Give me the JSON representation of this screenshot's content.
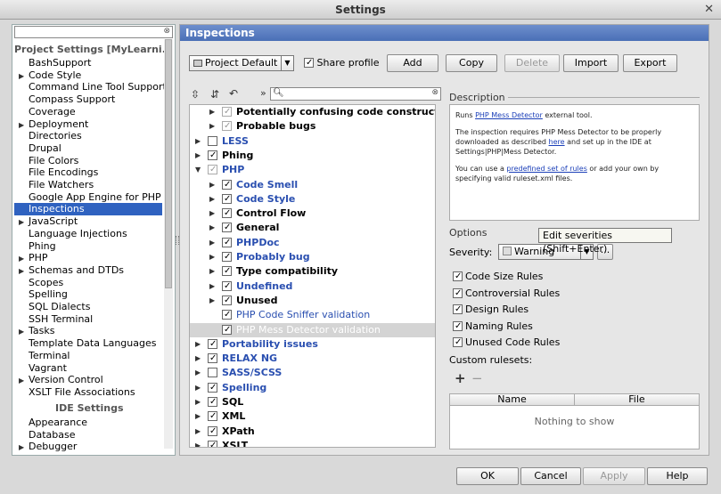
{
  "window": {
    "title": "Settings",
    "close_glyph": "✕"
  },
  "left": {
    "search_clear": "⊗",
    "project_header": "Project Settings [MyLearni...",
    "ide_header": "IDE Settings",
    "items": [
      {
        "label": "BashSupport",
        "arrow": ""
      },
      {
        "label": "Code Style",
        "arrow": "▶"
      },
      {
        "label": "Command Line Tool Support",
        "arrow": ""
      },
      {
        "label": "Compass Support",
        "arrow": ""
      },
      {
        "label": "Coverage",
        "arrow": ""
      },
      {
        "label": "Deployment",
        "arrow": "▶"
      },
      {
        "label": "Directories",
        "arrow": ""
      },
      {
        "label": "Drupal",
        "arrow": ""
      },
      {
        "label": "File Colors",
        "arrow": ""
      },
      {
        "label": "File Encodings",
        "arrow": ""
      },
      {
        "label": "File Watchers",
        "arrow": ""
      },
      {
        "label": "Google App Engine for PHP",
        "arrow": ""
      },
      {
        "label": "Inspections",
        "arrow": "",
        "selected": true
      },
      {
        "label": "JavaScript",
        "arrow": "▶"
      },
      {
        "label": "Language Injections",
        "arrow": ""
      },
      {
        "label": "Phing",
        "arrow": ""
      },
      {
        "label": "PHP",
        "arrow": "▶"
      },
      {
        "label": "Schemas and DTDs",
        "arrow": "▶"
      },
      {
        "label": "Scopes",
        "arrow": ""
      },
      {
        "label": "Spelling",
        "arrow": ""
      },
      {
        "label": "SQL Dialects",
        "arrow": ""
      },
      {
        "label": "SSH Terminal",
        "arrow": ""
      },
      {
        "label": "Tasks",
        "arrow": "▶"
      },
      {
        "label": "Template Data Languages",
        "arrow": ""
      },
      {
        "label": "Terminal",
        "arrow": ""
      },
      {
        "label": "Vagrant",
        "arrow": ""
      },
      {
        "label": "Version Control",
        "arrow": "▶"
      },
      {
        "label": "XSLT File Associations",
        "arrow": ""
      }
    ],
    "ide_items": [
      {
        "label": "Appearance",
        "arrow": ""
      },
      {
        "label": "Database",
        "arrow": ""
      },
      {
        "label": "Debugger",
        "arrow": "▶"
      }
    ]
  },
  "right": {
    "header": "Inspections",
    "profile": "Project Default",
    "share_profile": "Share profile",
    "buttons": {
      "add": "Add",
      "copy": "Copy",
      "delete": "Delete",
      "import": "Import",
      "export": "Export"
    },
    "filter_prefix": "»",
    "search_clear": "⊗",
    "tree": [
      {
        "label": "Potentially confusing code constructs",
        "level": 1,
        "arrow": "▶",
        "checked": "dim",
        "style": "bold"
      },
      {
        "label": "Probable bugs",
        "level": 1,
        "arrow": "▶",
        "checked": "dim",
        "style": "bold"
      },
      {
        "label": "LESS",
        "level": 0,
        "arrow": "▶",
        "checked": "off",
        "style": "blue"
      },
      {
        "label": "Phing",
        "level": 0,
        "arrow": "▶",
        "checked": "on",
        "style": "bold"
      },
      {
        "label": "PHP",
        "level": 0,
        "arrow": "▼",
        "checked": "dim",
        "style": "blue"
      },
      {
        "label": "Code Smell",
        "level": 1,
        "arrow": "▶",
        "checked": "on",
        "style": "blue"
      },
      {
        "label": "Code Style",
        "level": 1,
        "arrow": "▶",
        "checked": "on",
        "style": "blue"
      },
      {
        "label": "Control Flow",
        "level": 1,
        "arrow": "▶",
        "checked": "on",
        "style": "bold"
      },
      {
        "label": "General",
        "level": 1,
        "arrow": "▶",
        "checked": "on",
        "style": "bold"
      },
      {
        "label": "PHPDoc",
        "level": 1,
        "arrow": "▶",
        "checked": "on",
        "style": "blue"
      },
      {
        "label": "Probably bug",
        "level": 1,
        "arrow": "▶",
        "checked": "on",
        "style": "blue"
      },
      {
        "label": "Type compatibility",
        "level": 1,
        "arrow": "▶",
        "checked": "on",
        "style": "bold"
      },
      {
        "label": "Undefined",
        "level": 1,
        "arrow": "▶",
        "checked": "on",
        "style": "blue"
      },
      {
        "label": "Unused",
        "level": 1,
        "arrow": "▶",
        "checked": "on",
        "style": "bold"
      },
      {
        "label": "PHP Code Sniffer validation",
        "level": 1,
        "arrow": "",
        "checked": "on",
        "style": "norm"
      },
      {
        "label": "PHP Mess Detector validation",
        "level": 1,
        "arrow": "",
        "checked": "on",
        "style": "sel"
      },
      {
        "label": "Portability issues",
        "level": 0,
        "arrow": "▶",
        "checked": "on",
        "style": "blue"
      },
      {
        "label": "RELAX NG",
        "level": 0,
        "arrow": "▶",
        "checked": "on",
        "style": "blue"
      },
      {
        "label": "SASS/SCSS",
        "level": 0,
        "arrow": "▶",
        "checked": "off",
        "style": "blue"
      },
      {
        "label": "Spelling",
        "level": 0,
        "arrow": "▶",
        "checked": "on",
        "style": "blue"
      },
      {
        "label": "SQL",
        "level": 0,
        "arrow": "▶",
        "checked": "on",
        "style": "bold"
      },
      {
        "label": "XML",
        "level": 0,
        "arrow": "▶",
        "checked": "on",
        "style": "bold"
      },
      {
        "label": "XPath",
        "level": 0,
        "arrow": "▶",
        "checked": "on",
        "style": "bold"
      },
      {
        "label": "XSLT",
        "level": 0,
        "arrow": "▶",
        "checked": "on",
        "style": "bold"
      }
    ],
    "description": {
      "label": "Description",
      "p1_pre": "Runs ",
      "p1_link": "PHP Mess Detector",
      "p1_post": " external tool.",
      "p2_pre": "The inspection requires PHP Mess Detector to be properly downloaded as described ",
      "p2_link": "here",
      "p2_post": " and set up in the IDE at Settings|PHP|Mess Detector.",
      "p3_pre": "You can use a ",
      "p3_link": "predefined set of rules",
      "p3_post": " or add your own by specifying valid ruleset.xml files."
    },
    "options": {
      "label": "Options",
      "severity_label": "Severity:",
      "severity_value": "Warning",
      "severity_button": "...",
      "tooltip": "Edit severities (Shift+Enter)",
      "rules": [
        {
          "label": "Code Size Rules",
          "checked": true
        },
        {
          "label": "Controversial Rules",
          "checked": true
        },
        {
          "label": "Design Rules",
          "checked": true
        },
        {
          "label": "Naming Rules",
          "checked": true
        },
        {
          "label": "Unused Code Rules",
          "checked": true
        }
      ],
      "custom_label": "Custom rulesets:",
      "plus": "+",
      "minus": "−",
      "table_headers": [
        "Name",
        "File"
      ],
      "empty": "Nothing to show"
    }
  },
  "footer": {
    "ok": "OK",
    "cancel": "Cancel",
    "apply": "Apply",
    "help": "Help"
  }
}
